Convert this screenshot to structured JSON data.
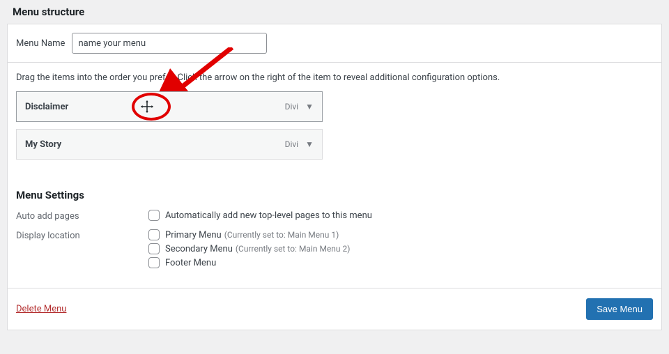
{
  "header": {
    "title": "Menu structure"
  },
  "top": {
    "label": "Menu Name",
    "placeholder": "name your menu",
    "value": "name your menu"
  },
  "instructions": "Drag the items into the order you prefer. Click the arrow on the right of the item to reveal additional configuration options.",
  "items": [
    {
      "title": "Disclaimer",
      "type": "Divi",
      "dragging": true
    },
    {
      "title": "My Story",
      "type": "Divi",
      "dragging": false
    }
  ],
  "settings": {
    "heading": "Menu Settings",
    "rows": [
      {
        "label": "Auto add pages",
        "options": [
          {
            "text": "Automatically add new top-level pages to this menu",
            "sub": ""
          }
        ]
      },
      {
        "label": "Display location",
        "options": [
          {
            "text": "Primary Menu",
            "sub": "(Currently set to: Main Menu 1)"
          },
          {
            "text": "Secondary Menu",
            "sub": "(Currently set to: Main Menu 2)"
          },
          {
            "text": "Footer Menu",
            "sub": ""
          }
        ]
      }
    ]
  },
  "footer": {
    "delete": "Delete Menu",
    "save": "Save Menu"
  },
  "annotations": {
    "move_icon": "move-cursor-icon",
    "ellipse_color": "#e10000",
    "arrow_color": "#e10000"
  }
}
